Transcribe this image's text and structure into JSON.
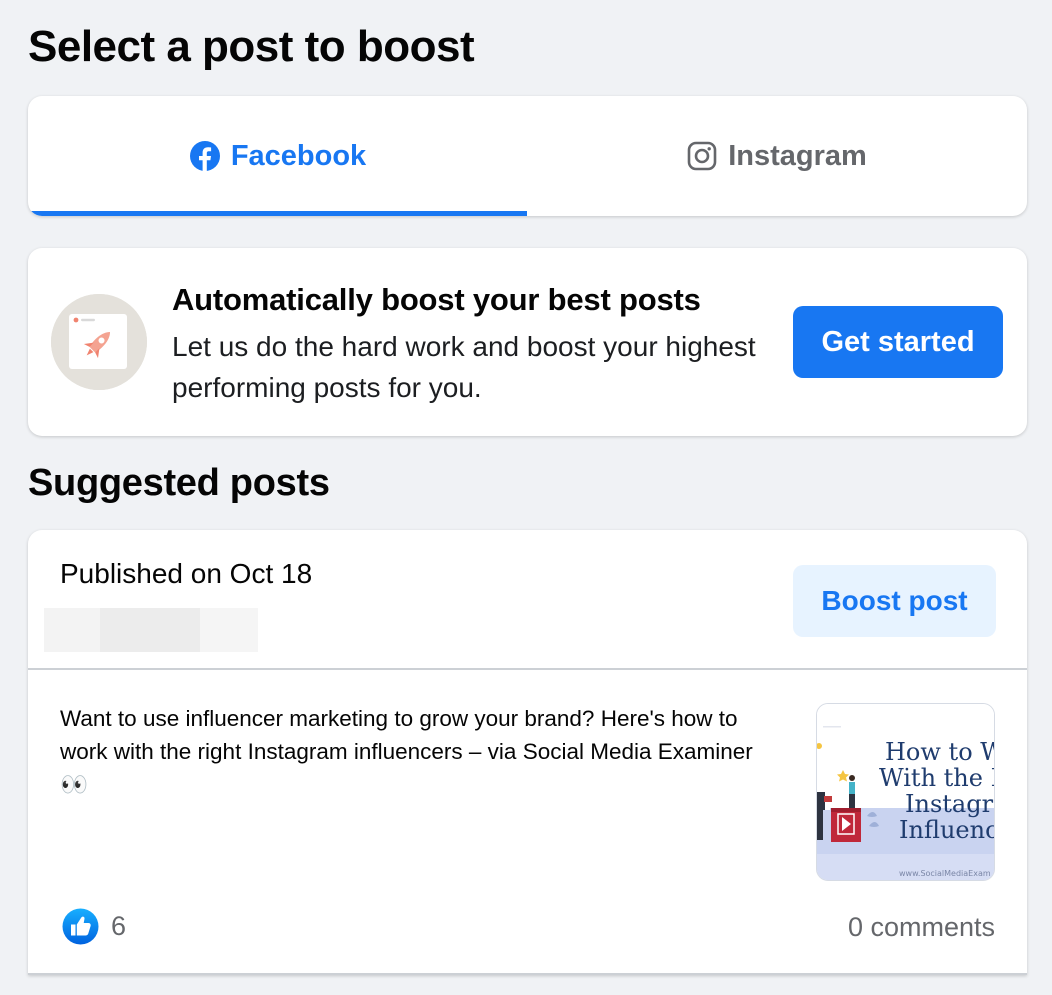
{
  "page_title": "Select a post to boost",
  "tabs": [
    {
      "label": "Facebook",
      "icon": "facebook-icon",
      "active": true
    },
    {
      "label": "Instagram",
      "icon": "instagram-icon",
      "active": false
    }
  ],
  "auto_boost": {
    "title": "Automatically boost your best posts",
    "description": "Let us do the hard work and boost your highest performing posts for you.",
    "button_label": "Get started",
    "icon": "rocket-icon"
  },
  "suggested": {
    "section_title": "Suggested posts",
    "post": {
      "published_label": "Published on Oct 18",
      "boost_label": "Boost post",
      "text": "Want to use influencer marketing to grow your brand? Here's how to work with the right Instagram influencers – via Social Media Examiner 👀",
      "thumbnail": {
        "headline_lines": [
          "How to W",
          "With the I",
          "Instagra",
          "Influenc"
        ],
        "footer": "www.SocialMediaExam"
      },
      "like_count": "6",
      "comments_label": "0 comments"
    }
  },
  "colors": {
    "accent": "#1877f2",
    "background": "#f0f2f5",
    "secondary_text": "#65676b",
    "boost_bg": "#e7f3ff"
  }
}
